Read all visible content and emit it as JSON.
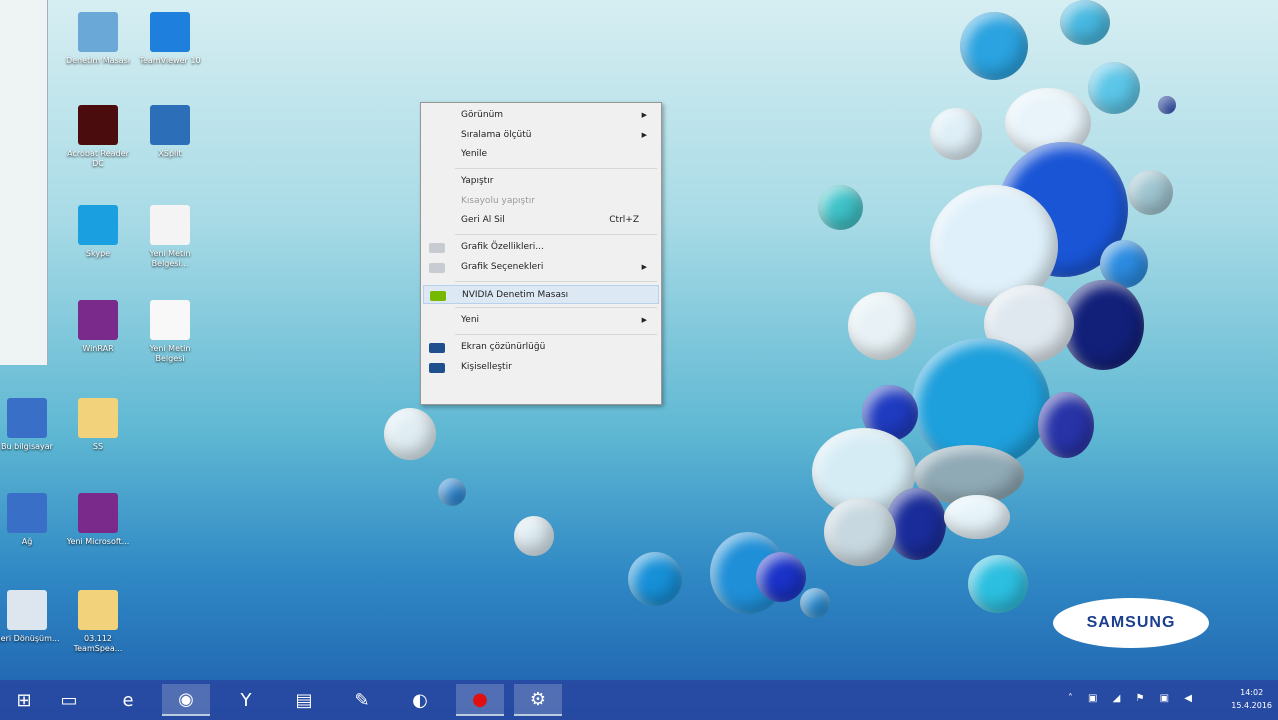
{
  "desktop_icons": [
    {
      "label": "Denetim Masası",
      "color": "#6aa8d8"
    },
    {
      "label": "TeamViewer 10",
      "color": "#1f7fdc"
    },
    {
      "label": "Acrobat Reader DC",
      "color": "#4a0c0c"
    },
    {
      "label": "XSplit",
      "color": "#2c6fb8"
    },
    {
      "label": "Skype",
      "color": "#1aa0e0"
    },
    {
      "label": "Yeni Metin Belgesi...",
      "color": "#f4f4f4"
    },
    {
      "label": "WinRAR",
      "color": "#7a2a8a"
    },
    {
      "label": "Yeni Metin Belgesi",
      "color": "#f8f8f8"
    },
    {
      "label": "Bu bilgisayar",
      "color": "#3a6fc8"
    },
    {
      "label": "SS",
      "color": "#f2d27a"
    },
    {
      "label": "Ağ",
      "color": "#3a6fc8"
    },
    {
      "label": "Yeni Microsoft...",
      "color": "#7a2a8a"
    },
    {
      "label": "Geri Dönüşüm...",
      "color": "#dde6ee"
    },
    {
      "label": "03.112 TeamSpea...",
      "color": "#f2d27a"
    }
  ],
  "context_menu": {
    "items": [
      {
        "label": "Görünüm",
        "submenu": true
      },
      {
        "label": "Sıralama ölçütü",
        "submenu": true
      },
      {
        "label": "Yenile"
      },
      {
        "sep": true
      },
      {
        "label": "Yapıştır"
      },
      {
        "label": "Kısayolu yapıştır",
        "disabled": true
      },
      {
        "label": "Geri Al Sil",
        "shortcut": "Ctrl+Z"
      },
      {
        "sep": true
      },
      {
        "label": "Grafik Özellikleri...",
        "icon": "intel-graphics-icon"
      },
      {
        "label": "Grafik Seçenekleri",
        "icon": "intel-graphics-icon",
        "submenu": true
      },
      {
        "sep": true
      },
      {
        "label": "NVIDIA Denetim Masası",
        "icon": "nvidia-icon",
        "highlighted": true
      },
      {
        "sep": true
      },
      {
        "label": "Yeni",
        "submenu": true
      },
      {
        "sep": true
      },
      {
        "label": "Ekran çözünürlüğü",
        "icon": "display-icon"
      },
      {
        "label": "Kişiselleştir",
        "icon": "personalize-icon"
      }
    ]
  },
  "brand": "SAMSUNG",
  "taskbar": {
    "apps": [
      {
        "name": "start",
        "glyph": "⊞"
      },
      {
        "name": "desktop",
        "glyph": "▭"
      },
      {
        "name": "internet-explorer",
        "glyph": "e"
      },
      {
        "name": "chrome",
        "glyph": "◉",
        "active": true
      },
      {
        "name": "yandex",
        "glyph": "Y"
      },
      {
        "name": "file-explorer",
        "glyph": "▤"
      },
      {
        "name": "paint",
        "glyph": "✎"
      },
      {
        "name": "teamspeak",
        "glyph": "◐"
      },
      {
        "name": "recorder",
        "glyph": "●",
        "active": true
      },
      {
        "name": "settings-app",
        "glyph": "⚙",
        "active": true
      }
    ],
    "tray_glyphs": "˄ ▣ ◢ ⚑ ▣ ◀",
    "time": "14:02",
    "date": "15.4.2016"
  }
}
